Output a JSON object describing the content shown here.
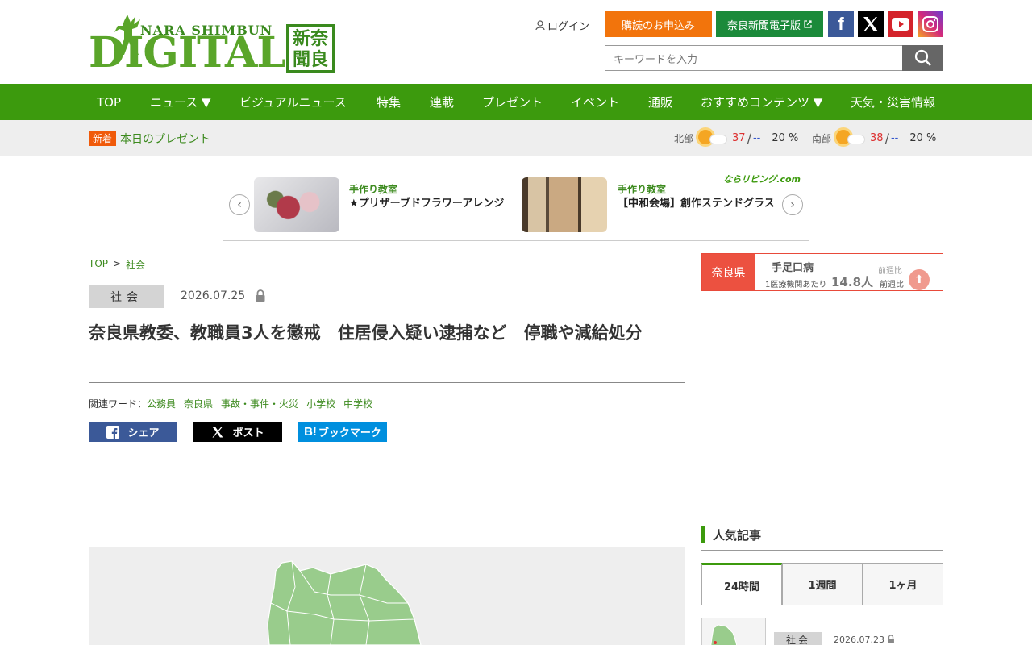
{
  "header": {
    "logo_top": "NARA SHIMBUN",
    "logo_main": "DIGITAL",
    "logo_kanji": "新奈\n聞良",
    "login_label": "ログイン",
    "subscribe_label": "購読のお申込み",
    "edition_label": "奈良新聞電子版",
    "search_placeholder": "キーワードを入力"
  },
  "nav": {
    "items": [
      "TOP",
      "ニュース ▼",
      "ビジュアルニュース",
      "特集",
      "連載",
      "プレゼント",
      "イベント",
      "通販",
      "おすすめコンテンツ ▼",
      "天気・災害情報"
    ]
  },
  "subbar": {
    "new_badge": "新着",
    "new_link": "本日のプレゼント",
    "weather": [
      {
        "area": "北部",
        "high": "37",
        "low": "--",
        "rain": "20 %"
      },
      {
        "area": "南部",
        "high": "38",
        "low": "--",
        "rain": "20 %"
      }
    ]
  },
  "carousel": {
    "brand": "ならリビング.com",
    "prev": "‹",
    "next": "›",
    "items": [
      {
        "category": "手作り教室",
        "title": "★プリザーブドフラワーアレンジ"
      },
      {
        "category": "手作り教室",
        "title": "【中和会場】創作ステンドグラス"
      }
    ]
  },
  "article": {
    "breadcrumb": [
      "TOP",
      "社会"
    ],
    "breadcrumb_sep": ">",
    "category": "社会",
    "date": "2026.07.25",
    "headline": "奈良県教委、教職員3人を懲戒　住居侵入疑い逮捕など　停職や減給処分",
    "keywords_label": "関連ワード：",
    "keywords": [
      "公務員",
      "奈良県",
      "事故・事件・火災",
      "小学校",
      "中学校"
    ],
    "share": {
      "facebook": "シェア",
      "x": "ポスト",
      "hatena": "ブックマーク"
    }
  },
  "sidebar": {
    "disease": {
      "pref": "奈良県",
      "name": "手足口病",
      "sub": "1医療機関あたり",
      "value": "14.8人",
      "week_label": "前週比"
    },
    "popular": {
      "title": "人気記事",
      "tabs": [
        "24時間",
        "1週間",
        "1ヶ月"
      ],
      "first": {
        "category": "社会",
        "date": "2026.07.23"
      }
    }
  },
  "colors": {
    "brand_green": "#3c9a0d",
    "accent_orange": "#f2740c",
    "edition_green": "#1b8a3a",
    "alert_red": "#ec5140"
  }
}
